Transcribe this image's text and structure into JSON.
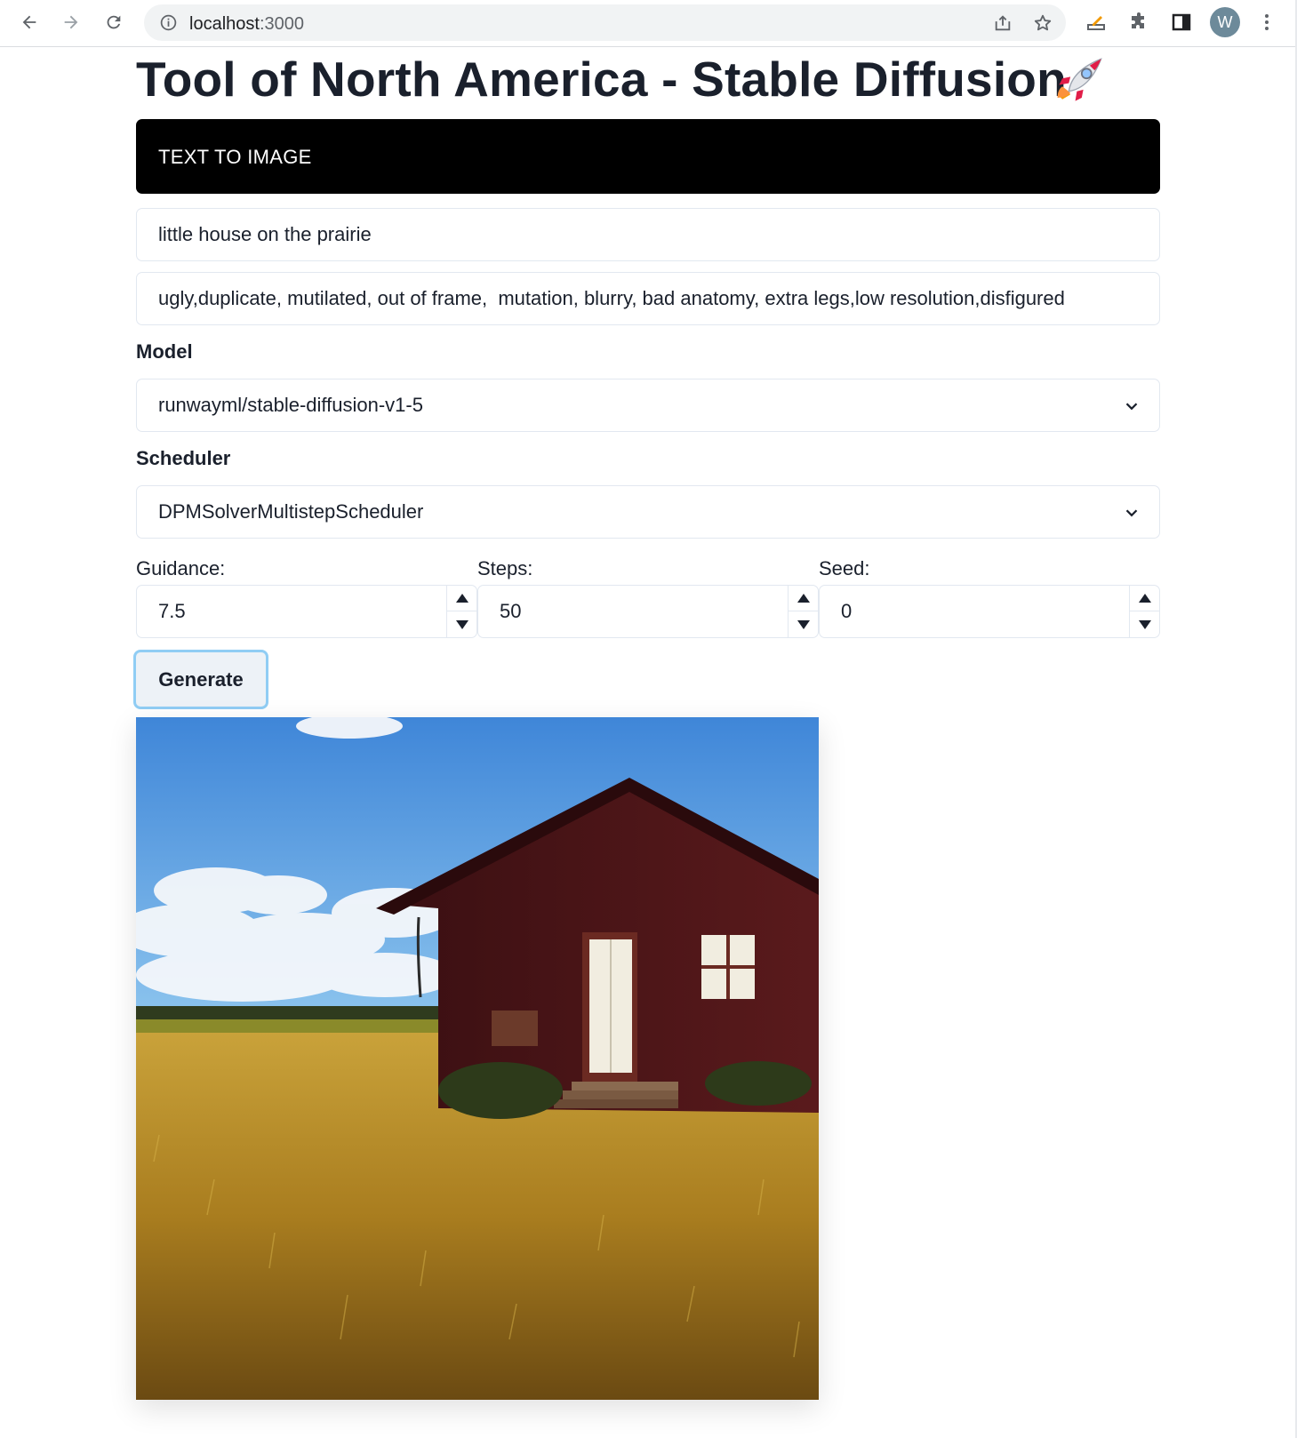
{
  "browser": {
    "url_host": "localhost",
    "url_port": ":3000",
    "avatar_letter": "W"
  },
  "header": {
    "title": "Tool of North America - Stable Diffusion"
  },
  "tab": {
    "label": "TEXT TO IMAGE"
  },
  "prompt": {
    "value": "little house on the prairie"
  },
  "negative_prompt": {
    "value": "ugly,duplicate, mutilated, out of frame,  mutation, blurry, bad anatomy, extra legs,low resolution,disfigured"
  },
  "model": {
    "label": "Model",
    "selected": "runwayml/stable-diffusion-v1-5"
  },
  "scheduler": {
    "label": "Scheduler",
    "selected": "DPMSolverMultistepScheduler"
  },
  "guidance": {
    "label": "Guidance:",
    "value": "7.5"
  },
  "steps": {
    "label": "Steps:",
    "value": "50"
  },
  "seed": {
    "label": "Seed:",
    "value": "0"
  },
  "generate": {
    "label": "Generate"
  },
  "colors": {
    "accent_border": "#90cdf4",
    "tab_bg": "#000000",
    "button_bg": "#edf2f7"
  }
}
